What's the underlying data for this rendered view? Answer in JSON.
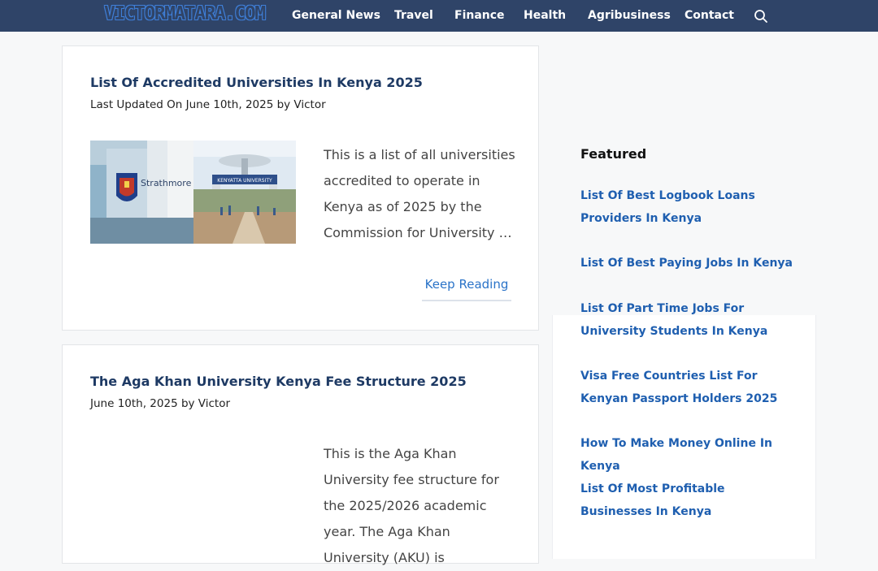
{
  "header": {
    "logo": "VICTORMATARA.COM",
    "nav": [
      "General News",
      "Travel",
      "Finance",
      "Health",
      "Agribusiness",
      "Contact"
    ]
  },
  "posts": [
    {
      "title": "List Of Accredited Universities In Kenya 2025",
      "meta": "Last Updated On June 10th, 2025 by Victor",
      "excerpt": "This is a list of all universities accredited to operate in Kenya as of 2025 by the Commission for University …",
      "read_more": "Keep Reading",
      "image_text_left": "Strathmore",
      "image_text_right": "KENYATTA UNIVERSITY"
    },
    {
      "title": "The Aga Khan University Kenya Fee Structure 2025",
      "meta": "June 10th, 2025 by Victor",
      "excerpt": "This is the Aga Khan University fee structure for the 2025/2026 academic year. The Aga Khan University (AKU) is"
    }
  ],
  "sidebar": {
    "featured_title": "Featured",
    "links": [
      "List Of Best Logbook Loans Providers In Kenya",
      "List Of Best Paying Jobs In Kenya",
      "List Of Part Time Jobs For University Students In Kenya",
      "Visa Free Countries List For Kenyan Passport Holders 2025",
      "How To Make Money Online In Kenya",
      "List Of Most Profitable Businesses In Kenya"
    ]
  },
  "colors": {
    "header_bg": "#2f4468",
    "link": "#1f5fb0",
    "title": "#1e3a64"
  },
  "icons": {
    "search": "search-icon"
  }
}
